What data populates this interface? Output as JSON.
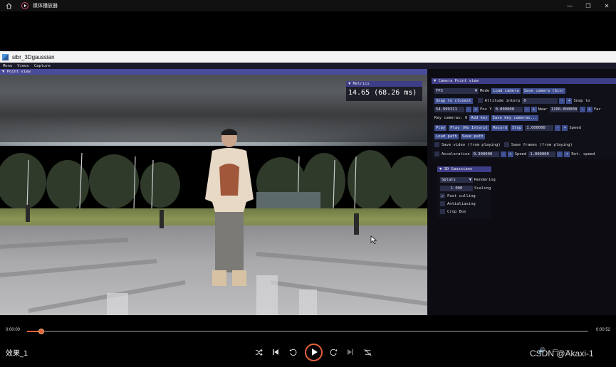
{
  "player": {
    "app_title": "媒体播放器",
    "window_buttons": [
      "—",
      "❐",
      "✕"
    ],
    "media_title": "效果_1",
    "time_current": "0:00:00",
    "time_total": "0:00:52",
    "progress": 0.025,
    "watermark": "CSDN @Akaxi-1",
    "accent_color": "#e0613a"
  },
  "sibr": {
    "window_title": "sibr_3Dgaussian",
    "menu": [
      "Menu",
      "Views",
      "Capture"
    ],
    "point_view_header": "Point view",
    "metrics": {
      "header": "Metrics",
      "value": "14.65 (68.26 ms)"
    },
    "camera": {
      "header": "Camera Point view",
      "mode_value": "FPS",
      "mode_label": "Mode",
      "load_camera": "Load camera",
      "save_camera": "Save camera (bin)",
      "snap_closest": "Snap to closest",
      "altitude_label": "Altitude interp",
      "altitude_value": "0",
      "snap_to": "Snap to",
      "fovy_value": "54.999311",
      "fovy_label": "Fov Y",
      "near_input": "0.009000",
      "near_label": "Near",
      "far_input": "1100.000000",
      "far_label": "Far",
      "key_cameras_label": "Key cameras: 0",
      "add_key": "Add key",
      "save_key": "Save key cameras...",
      "play": "Play",
      "play_no_interp": "Play (No Interp)",
      "record": "Record",
      "stop": "Stop",
      "speed_value": "1.000000",
      "speed_label": "Speed",
      "load_path": "Load path",
      "save_path": "Save path",
      "save_video": "Save video (from playing)",
      "save_frames": "Save frames (from playing)",
      "accel_label": "Acceleration",
      "accel_value": "0.300000",
      "speed2_label": "Speed",
      "speed2_value": "1.000000",
      "rot_speed_label": "Rot. speed"
    },
    "gaussians": {
      "header": "3D Gaussians",
      "render_mode": "Splats",
      "render_label": "Rendering",
      "scaling_value": "1.000",
      "scaling_label": "Scaling",
      "fast_culling": "Fast culling",
      "fast_culling_checked": true,
      "antialiasing": "Antialiasing",
      "antialiasing_checked": false,
      "crop_box": "Crop Box",
      "crop_box_checked": false
    }
  }
}
